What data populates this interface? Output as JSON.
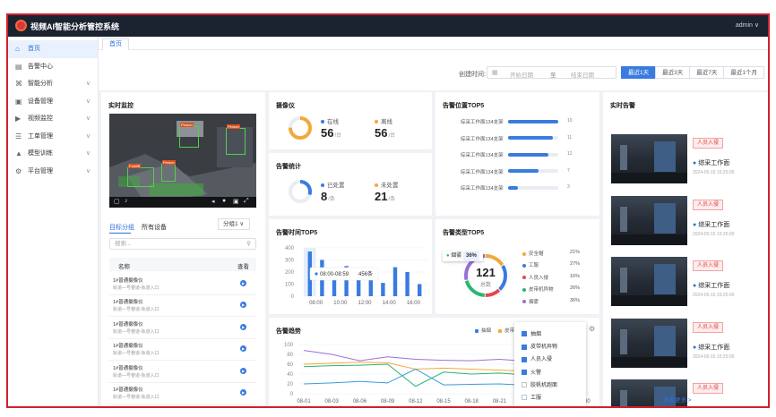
{
  "app": {
    "title": "视频AI智能分析管控系统",
    "user": "admin ∨"
  },
  "sidebar": {
    "items": [
      {
        "label": "首页",
        "icon": "home-icon",
        "glyph": "⌂",
        "active": true,
        "chevron": ""
      },
      {
        "label": "告警中心",
        "icon": "alert-list-icon",
        "glyph": "▤",
        "chevron": ""
      },
      {
        "label": "智能分析",
        "icon": "analysis-icon",
        "glyph": "⌘",
        "chevron": "∨"
      },
      {
        "label": "设备管理",
        "icon": "device-icon",
        "glyph": "▣",
        "chevron": "∨"
      },
      {
        "label": "视频监控",
        "icon": "video-icon",
        "glyph": "▶",
        "chevron": "∨"
      },
      {
        "label": "工单管理",
        "icon": "work-order-icon",
        "glyph": "☰",
        "chevron": "∨"
      },
      {
        "label": "模型训练",
        "icon": "model-icon",
        "glyph": "▲",
        "chevron": "∨"
      },
      {
        "label": "平台管理",
        "icon": "platform-icon",
        "glyph": "⚙",
        "chevron": "∨"
      }
    ]
  },
  "tabs": {
    "home": "首页"
  },
  "filter": {
    "label": "创建时间:",
    "start_placeholder": "开始日期",
    "separator": "至",
    "end_placeholder": "结束日期",
    "quick": [
      "最近1天",
      "最近3天",
      "最近7天",
      "最近1个月"
    ],
    "active_index": 0
  },
  "monitor": {
    "title": "实时监控",
    "detections": [
      "Person",
      "Person",
      "Forklift",
      "Person"
    ],
    "tabs": [
      "目标分组",
      "所有设备"
    ],
    "group_select": "分组1 ∨",
    "search_placeholder": "搜索...",
    "columns": [
      "名称",
      "查看"
    ],
    "devices": [
      {
        "name": "1#普通摄像仪",
        "location": "轨道—号巷道-轨道入口"
      },
      {
        "name": "1#普通摄像仪",
        "location": "轨道—号巷道-轨道入口"
      },
      {
        "name": "1#普通摄像仪",
        "location": "轨道—号巷道-轨道入口"
      },
      {
        "name": "1#普通摄像仪",
        "location": "轨道—号巷道-轨道入口"
      },
      {
        "name": "1#普通摄像仪",
        "location": "轨道—号巷道-轨道入口"
      },
      {
        "name": "1#普通摄像仪",
        "location": "轨道—号巷道-轨道入口"
      }
    ]
  },
  "cameras": {
    "title": "摄像仪",
    "online": {
      "label": "在线",
      "value": "56",
      "unit": "/台"
    },
    "offline": {
      "label": "离线",
      "value": "56",
      "unit": "/台"
    },
    "online_ratio": 0.75
  },
  "alarm_stats": {
    "title": "告警统计",
    "handled": {
      "label": "已处置",
      "value": "8",
      "unit": "/条"
    },
    "unhandled": {
      "label": "未处置",
      "value": "21",
      "unit": "/条"
    },
    "handled_ratio": 0.3
  },
  "location_top5": {
    "title": "告警位置TOP5",
    "items": [
      {
        "label": "综采工作面134支架",
        "value": 10,
        "display": "10"
      },
      {
        "label": "综采工作面134支架",
        "value": 9,
        "display": "11"
      },
      {
        "label": "综采工作面134支架",
        "value": 8,
        "display": "12"
      },
      {
        "label": "综采工作面134支架",
        "value": 6,
        "display": "7"
      },
      {
        "label": "综采工作面134支架",
        "value": 2,
        "display": "3"
      }
    ]
  },
  "time_top5": {
    "chart_data": {
      "type": "bar",
      "title": "告警时间TOP5",
      "categories": [
        "08:00",
        "10:00",
        "12:00",
        "14:00",
        "16:00"
      ],
      "y_ticks": [
        "400",
        "300",
        "200",
        "100",
        "0"
      ],
      "ylim": [
        0,
        400
      ],
      "values": [
        370,
        300,
        185,
        250,
        225,
        230,
        110,
        240,
        200,
        100
      ],
      "highlight_index": 0,
      "tooltip": {
        "time": "08:00-08:59",
        "value": "456条"
      }
    }
  },
  "type_top5": {
    "title": "告警类型TOP5",
    "center_value": "121",
    "center_label": "总数",
    "badge": {
      "label": "烟雾",
      "value": "36%"
    },
    "chart_data": {
      "type": "pie",
      "slices": [
        {
          "label": "安全帽",
          "value": 21,
          "display": "21%",
          "color": "#f2a93b"
        },
        {
          "label": "工服",
          "value": 27,
          "display": "27%",
          "color": "#3a7be0"
        },
        {
          "label": "人员入侵",
          "value": 16,
          "display": "16%",
          "color": "#e5484d"
        },
        {
          "label": "皮带机异物",
          "value": 26,
          "display": "26%",
          "color": "#2bb673"
        },
        {
          "label": "烟雾",
          "value": 36,
          "display": "36%",
          "color": "#9b6fd8"
        }
      ]
    }
  },
  "trend": {
    "title": "告警趋势",
    "legend": [
      {
        "label": "抽烟",
        "color": "#3a7be0"
      },
      {
        "label": "皮带",
        "color": "#f2a93b"
      }
    ],
    "chart_data": {
      "type": "line",
      "x": [
        "08-01",
        "08-03",
        "08-06",
        "08-09",
        "08-12",
        "08-15",
        "08-18",
        "08-21",
        "08-24",
        "08-27",
        "08-30"
      ],
      "y_ticks": [
        "100",
        "80",
        "60",
        "40",
        "20",
        "0"
      ],
      "ylim": [
        0,
        100
      ],
      "series": [
        {
          "color": "#9b6fd8",
          "values": [
            88,
            80,
            67,
            75,
            70,
            68,
            67,
            70,
            66,
            64,
            68
          ]
        },
        {
          "color": "#f2a93b",
          "values": [
            60,
            62,
            64,
            63,
            50,
            52,
            50,
            48,
            46,
            48,
            50
          ]
        },
        {
          "color": "#2bb673",
          "values": [
            55,
            57,
            58,
            60,
            15,
            44,
            40,
            42,
            38,
            42,
            40
          ]
        },
        {
          "color": "#3a9ee0",
          "values": [
            20,
            22,
            25,
            22,
            50,
            18,
            19,
            20,
            17,
            18,
            18
          ]
        }
      ]
    },
    "series_options": [
      {
        "label": "抽烟",
        "checked": true
      },
      {
        "label": "皮带机异物",
        "checked": true
      },
      {
        "label": "人员入侵",
        "checked": true
      },
      {
        "label": "火警",
        "checked": true
      },
      {
        "label": "胶帆机跑面",
        "checked": false
      },
      {
        "label": "工服",
        "checked": false
      }
    ]
  },
  "alerts": {
    "title": "实时告警",
    "items": [
      {
        "tag": "人员入侵",
        "location": "综采工作面",
        "time": "2024-05-15 15:25:00"
      },
      {
        "tag": "人员入侵",
        "location": "综采工作面",
        "time": "2024-05-15 15:25:00"
      },
      {
        "tag": "人员入侵",
        "location": "综采工作面",
        "time": "2024-05-15 15:25:00"
      },
      {
        "tag": "人员入侵",
        "location": "综采工作面",
        "time": "2024-05-15 15:25:00"
      },
      {
        "tag": "人员入侵",
        "location": "",
        "time": ""
      }
    ],
    "more": "查看更多 >"
  }
}
